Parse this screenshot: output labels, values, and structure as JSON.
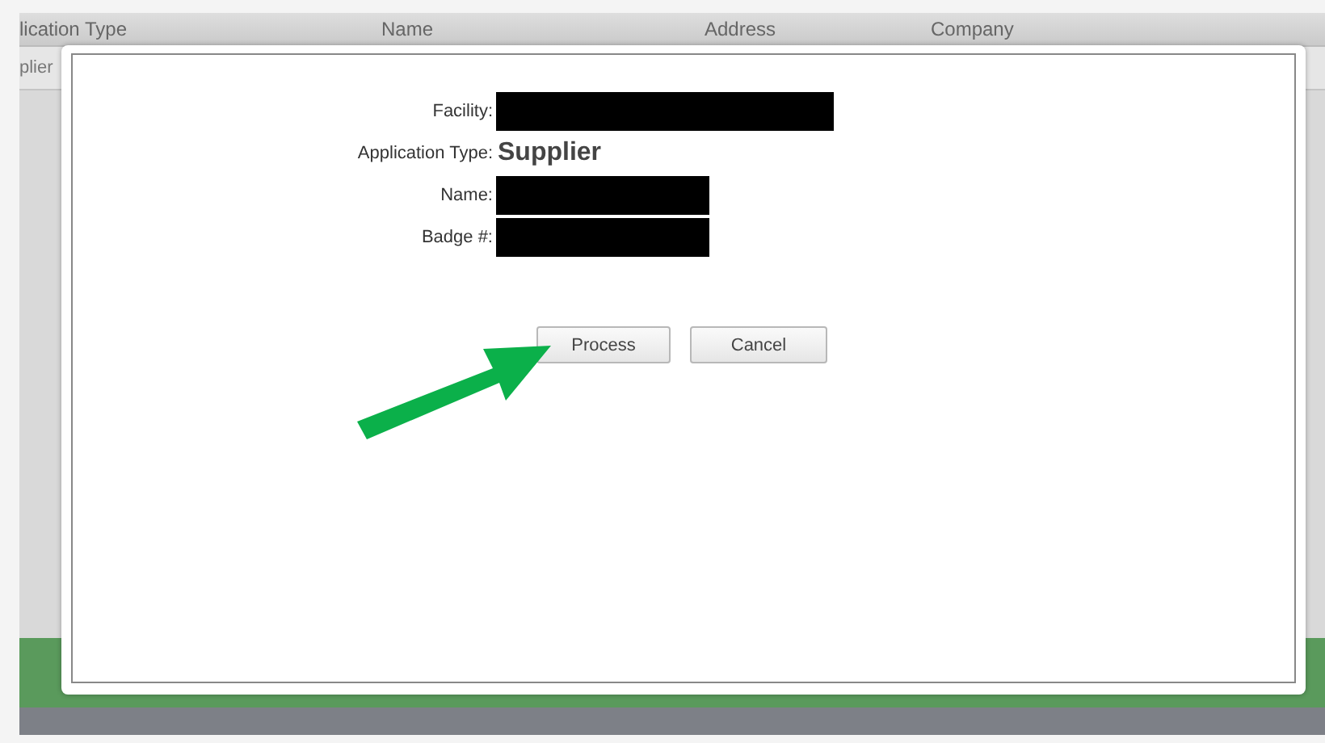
{
  "table": {
    "columns": [
      "lication Type",
      "Name",
      "Address",
      "Company"
    ],
    "rows": [
      [
        "plier"
      ]
    ]
  },
  "dialog": {
    "fields": [
      {
        "label": "Facility:",
        "kind": "redacted"
      },
      {
        "label": "Application Type:",
        "kind": "text",
        "value": "Supplier"
      },
      {
        "label": "Name:",
        "kind": "redacted"
      },
      {
        "label": "Badge #:",
        "kind": "redacted"
      }
    ],
    "buttons": [
      {
        "label": "Process"
      },
      {
        "label": "Cancel"
      }
    ]
  }
}
